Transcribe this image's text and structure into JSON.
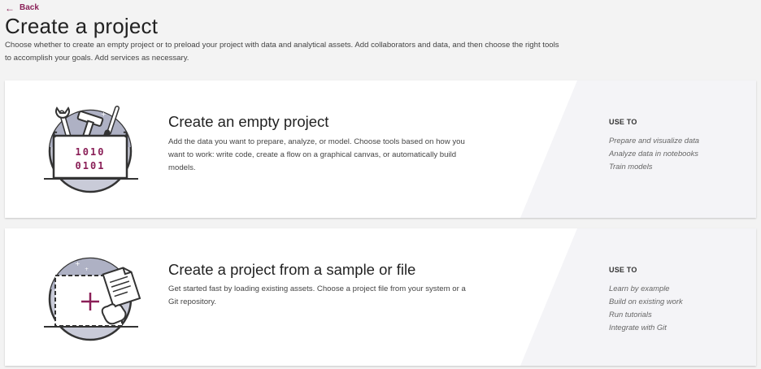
{
  "nav": {
    "back_label": "Back"
  },
  "page": {
    "title": "Create a project",
    "subtitle": "Choose whether to create an empty project or to preload your project with data and analytical assets. Add collaborators and data, and then choose the right tools to accomplish your goals. Add services as necessary."
  },
  "cards": [
    {
      "title": "Create an empty project",
      "description": "Add the data you want to prepare, analyze, or model. Choose tools based on how you want to work: write code, create a flow on a graphical canvas, or automatically build models.",
      "icon": "toolbox-binary-icon",
      "illustration_text": [
        "1010",
        "0101"
      ],
      "use_to_label": "USE TO",
      "use_to": [
        "Prepare and visualize data",
        "Analyze data in notebooks",
        "Train models"
      ]
    },
    {
      "title": "Create a project from a sample or file",
      "description": "Get started fast by loading existing assets. Choose a project file from your system or a Git repository.",
      "icon": "file-upload-icon",
      "use_to_label": "USE TO",
      "use_to": [
        "Learn by example",
        "Build on existing work",
        "Run tutorials",
        "Integrate with Git"
      ]
    }
  ],
  "colors": {
    "accent": "#8a1f57",
    "circle": "#c9cbd8",
    "card_bg": "#ffffff",
    "page_bg": "#f3f3f3"
  }
}
